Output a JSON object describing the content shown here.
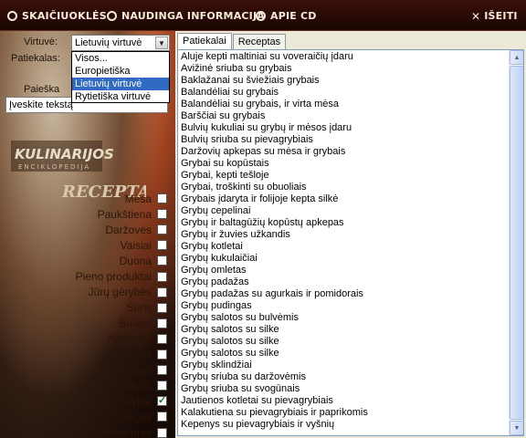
{
  "menu": {
    "calculators": "SKAIČIUOKLĖS",
    "info": "NAUDINGA INFORMACIJA",
    "about": "APIE CD",
    "exit": "IŠEITI"
  },
  "filters": {
    "cuisine_label": "Virtuvė:",
    "cuisine_value": "Lietuvių virtuvė",
    "cuisine_options": [
      "Visos...",
      "Europietiška",
      "Lietuvių virtuvė",
      "Rytietiška virtuvė"
    ],
    "cuisine_selected_index": 2,
    "dishes_label": "Patiekalas:",
    "search_label": "Paieška",
    "search_value": "Įveskite tekstą"
  },
  "logo": {
    "line1": "KULINARIJOS",
    "line2": "ENCIKLOPEDIJA",
    "line3": "RECEPTAI"
  },
  "categories": [
    {
      "label": "Mėsa",
      "checked": false
    },
    {
      "label": "Paukštiena",
      "checked": false
    },
    {
      "label": "Daržovės",
      "checked": false
    },
    {
      "label": "Vaisiai",
      "checked": false
    },
    {
      "label": "Duona",
      "checked": false
    },
    {
      "label": "Pieno produktai",
      "checked": false
    },
    {
      "label": "Jūrų gėrybės",
      "checked": false
    },
    {
      "label": "Sūris",
      "checked": false
    },
    {
      "label": "Bulvės",
      "checked": false
    },
    {
      "label": "Alkoholis",
      "checked": false
    },
    {
      "label": "Soja",
      "checked": false
    },
    {
      "label": "Kruopos",
      "checked": false
    },
    {
      "label": "Cukrus",
      "checked": false
    },
    {
      "label": "Grybai",
      "checked": true
    },
    {
      "label": "Uogos",
      "checked": false
    },
    {
      "label": "Makaronai",
      "checked": false
    }
  ],
  "tabs": [
    {
      "label": "Patiekalai",
      "active": true
    },
    {
      "label": "Receptas",
      "active": false
    }
  ],
  "recipes": [
    "Aluje kepti maltiniai su voveraičių įdaru",
    "Avižinė sriuba su grybais",
    "Baklažanai su šviežiais grybais",
    "Balandėliai su grybais",
    "Balandėliai su grybais, ir virta mėsa",
    "Barščiai su grybais",
    "Bulvių kukuliai su grybų ir mėsos įdaru",
    "Bulvių sriuba su pievagrybiais",
    "Daržovių apkepas su mėsa ir grybais",
    "Grybai su kopūstais",
    "Grybai, kepti tešloje",
    "Grybai, troškinti su obuoliais",
    "Grybais įdaryta ir folijoje kepta silkė",
    "Grybų cepelinai",
    "Grybų ir baltagūžių kopūstų apkepas",
    "Grybų ir žuvies užkandis",
    "Grybų kotletai",
    "Grybų kukulaičiai",
    "Grybų omletas",
    "Grybų padažas",
    "Grybų padažas su agurkais ir pomidorais",
    "Grybų pudingas",
    "Grybų salotos su bulvėmis",
    "Grybų salotos su silke",
    "Grybų salotos su silke",
    "Grybų salotos su silke",
    "Grybų sklindžiai",
    "Grybų sriuba su daržovėmis",
    "Grybų sriuba su svogūnais",
    "Jautienos kotletai su pievagrybiais",
    "Kalakutiena su pievagrybiais ir paprikomis",
    "Kepenys su pievagrybiais ir vyšnių"
  ],
  "colors": {
    "menu_bg": "#2a0a06",
    "selection": "#316ac5",
    "check_mark": "#1a7a1a"
  }
}
